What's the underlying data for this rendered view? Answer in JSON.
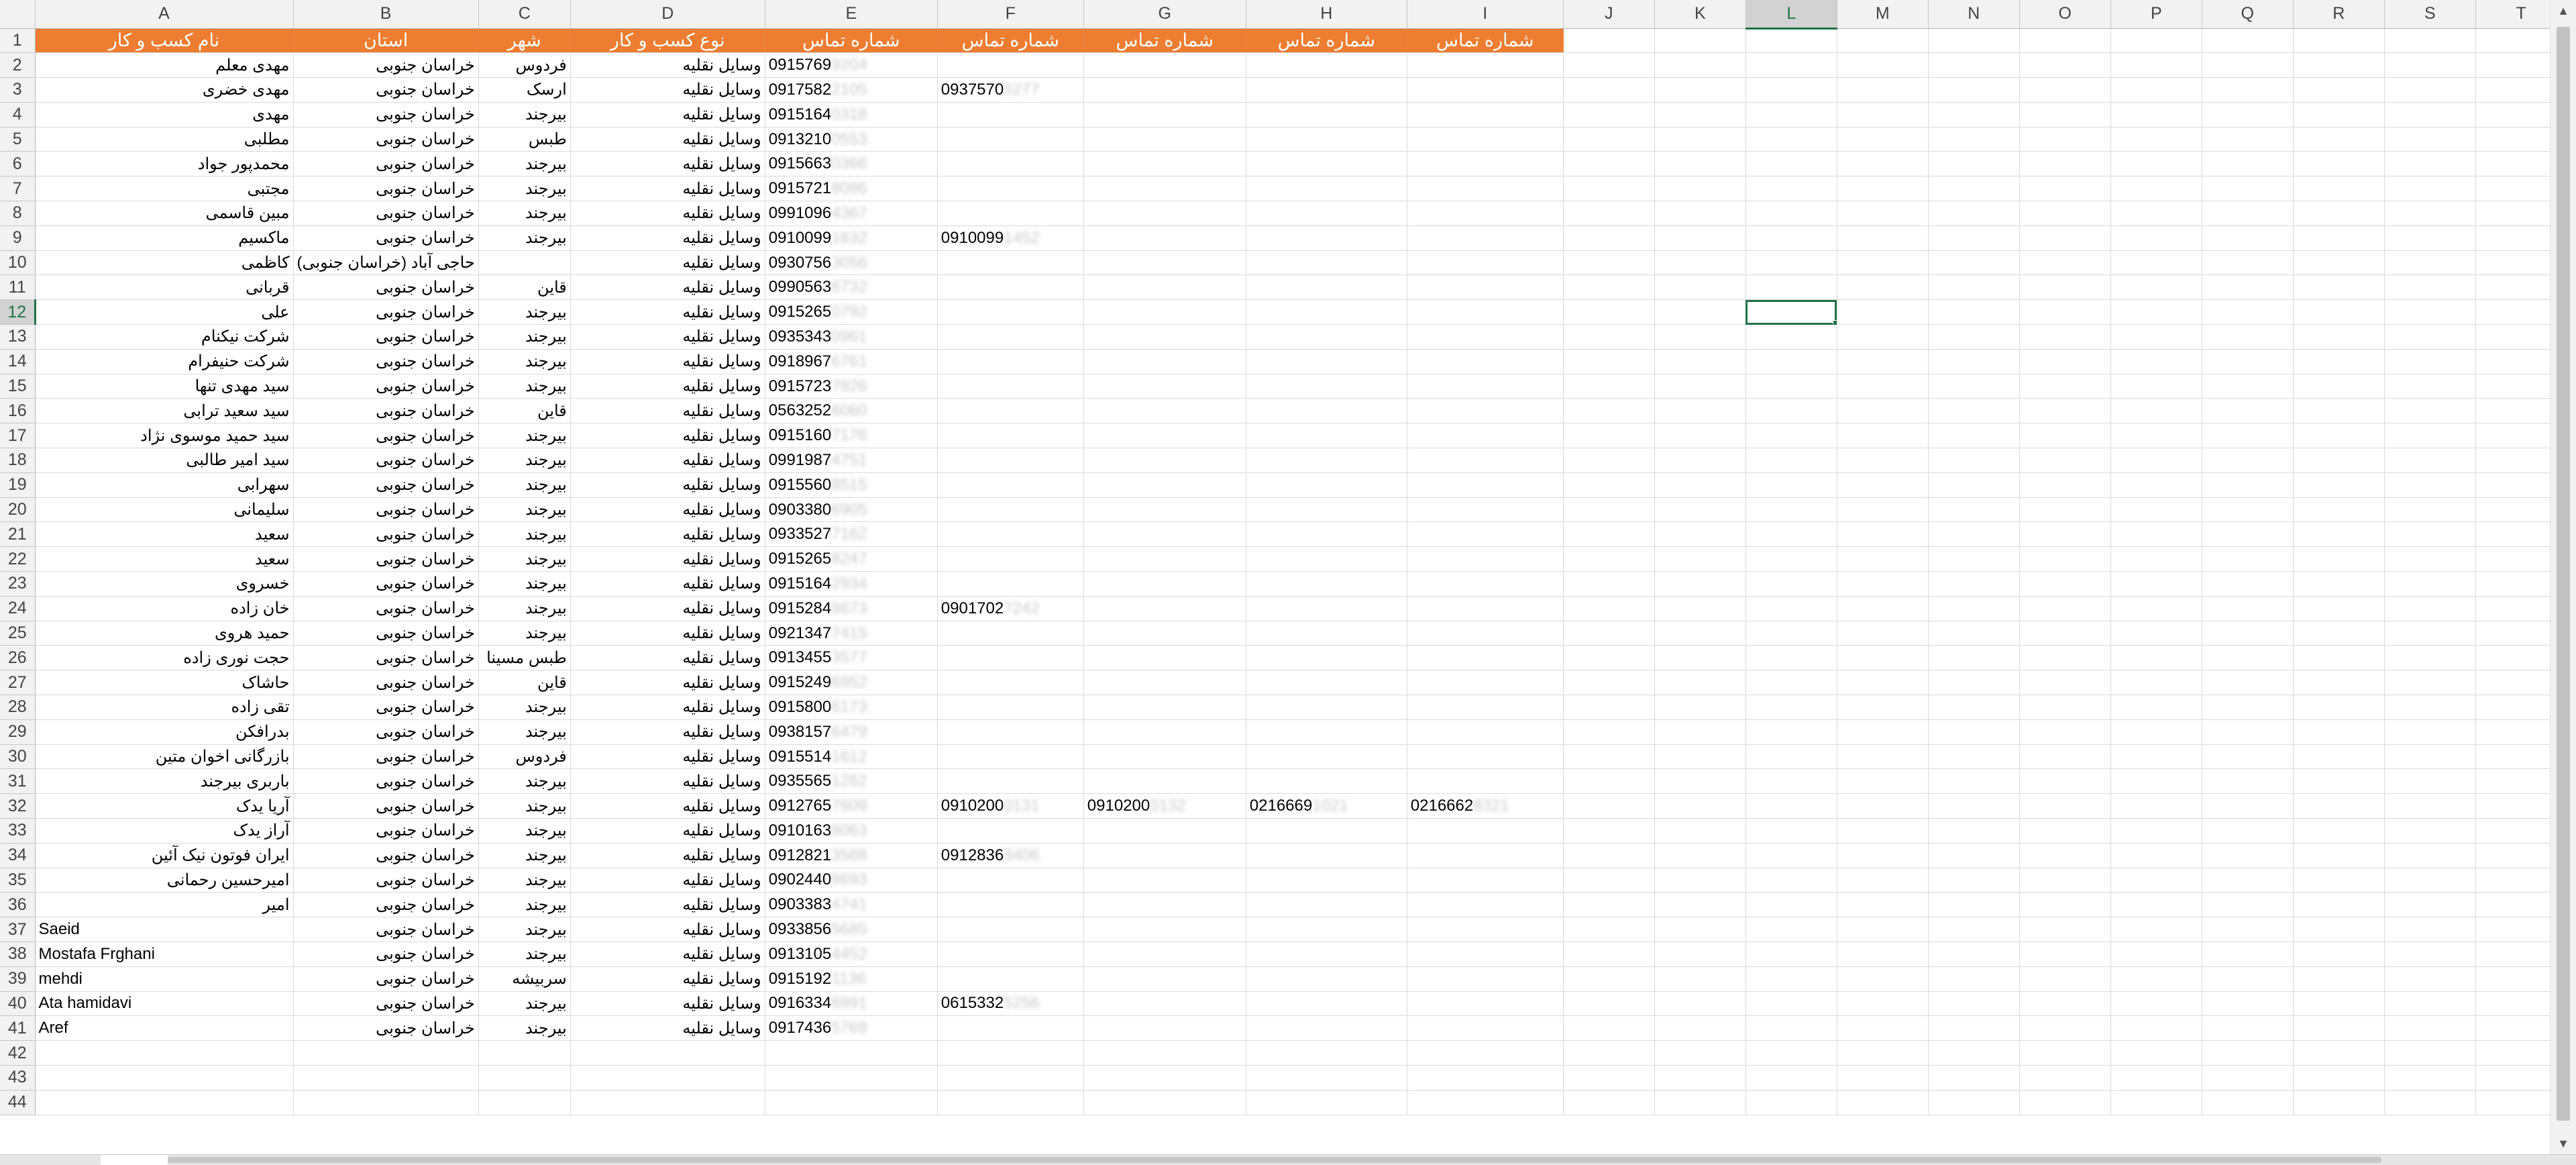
{
  "app": "Spreadsheet",
  "selected_cell": "L12",
  "header_color": "#ed7d31",
  "columns": [
    "A",
    "B",
    "C",
    "D",
    "E",
    "F",
    "G",
    "H",
    "I",
    "J",
    "K",
    "L",
    "M",
    "N",
    "O",
    "P",
    "Q",
    "R",
    "S",
    "T"
  ],
  "row_numbers": [
    1,
    2,
    3,
    4,
    5,
    6,
    7,
    8,
    9,
    10,
    11,
    12,
    13,
    14,
    15,
    16,
    17,
    18,
    19,
    20,
    21,
    22,
    23,
    24,
    25,
    26,
    27,
    28,
    29,
    30,
    31,
    32,
    33,
    34,
    35,
    36,
    37,
    38,
    39,
    40,
    41,
    42,
    43,
    44
  ],
  "headers": [
    "نام کسب و کار",
    "استان",
    "شهر",
    "نوع کسب و کار",
    "شماره تماس",
    "شماره تماس",
    "شماره تماس",
    "شماره تماس",
    "شماره تماس"
  ],
  "rows": [
    {
      "name": "مهدی معلم",
      "province": "خراسان جنوبی",
      "city": "فردوس",
      "type": "وسایل نقلیه",
      "phones": [
        [
          "0915769",
          "9204"
        ]
      ]
    },
    {
      "name": "مهدی خضری",
      "province": "خراسان جنوبی",
      "city": "ارسک",
      "type": "وسایل نقلیه",
      "phones": [
        [
          "0917582",
          "2105"
        ],
        [
          "0937570",
          "5277"
        ]
      ]
    },
    {
      "name": "مهدی",
      "province": "خراسان جنوبی",
      "city": "بیرجند",
      "type": "وسایل نقلیه",
      "phones": [
        [
          "0915164",
          "0318"
        ]
      ]
    },
    {
      "name": "مطلبی",
      "province": "خراسان جنوبی",
      "city": "طبس",
      "type": "وسایل نقلیه",
      "phones": [
        [
          "0913210",
          "0553"
        ]
      ]
    },
    {
      "name": "محمدپور جواد",
      "province": "خراسان جنوبی",
      "city": "بیرجند",
      "type": "وسایل نقلیه",
      "phones": [
        [
          "0915663",
          "0366"
        ]
      ]
    },
    {
      "name": "مجتبی",
      "province": "خراسان جنوبی",
      "city": "بیرجند",
      "type": "وسایل نقلیه",
      "phones": [
        [
          "0915721",
          "8086"
        ]
      ]
    },
    {
      "name": "مبین قاسمی",
      "province": "خراسان جنوبی",
      "city": "بیرجند",
      "type": "وسایل نقلیه",
      "phones": [
        [
          "0991096",
          "4367"
        ]
      ]
    },
    {
      "name": "ماکسیم",
      "province": "خراسان جنوبی",
      "city": "بیرجند",
      "type": "وسایل نقلیه",
      "phones": [
        [
          "0910099",
          "1632"
        ],
        [
          "0910099",
          "1452"
        ]
      ]
    },
    {
      "name": "کاظمی",
      "province": "حاجی آباد (خراسان جنوبی)",
      "city": "",
      "type": "وسایل نقلیه",
      "phones": [
        [
          "0930756",
          "3056"
        ]
      ]
    },
    {
      "name": "قربانی",
      "province": "خراسان جنوبی",
      "city": "قاین",
      "type": "وسایل نقلیه",
      "phones": [
        [
          "0990563",
          "6732"
        ]
      ]
    },
    {
      "name": "علی",
      "province": "خراسان جنوبی",
      "city": "بیرجند",
      "type": "وسایل نقلیه",
      "phones": [
        [
          "0915265",
          "0792"
        ]
      ]
    },
    {
      "name": "شرکت نیکنام",
      "province": "خراسان جنوبی",
      "city": "بیرجند",
      "type": "وسایل نقلیه",
      "phones": [
        [
          "0935343",
          "0961"
        ]
      ]
    },
    {
      "name": "شرکت حنیفرام",
      "province": "خراسان جنوبی",
      "city": "بیرجند",
      "type": "وسایل نقلیه",
      "phones": [
        [
          "0918967",
          "6761"
        ]
      ]
    },
    {
      "name": "سید مهدی تنها",
      "province": "خراسان جنوبی",
      "city": "بیرجند",
      "type": "وسایل نقلیه",
      "phones": [
        [
          "0915723",
          "7926"
        ]
      ]
    },
    {
      "name": "سید سعید ترابی",
      "province": "خراسان جنوبی",
      "city": "قاین",
      "type": "وسایل نقلیه",
      "phones": [
        [
          "0563252",
          "6060"
        ]
      ]
    },
    {
      "name": "سید حمید موسوی نژاد",
      "province": "خراسان جنوبی",
      "city": "بیرجند",
      "type": "وسایل نقلیه",
      "phones": [
        [
          "0915160",
          "7176"
        ]
      ]
    },
    {
      "name": "سید امیر طالبی",
      "province": "خراسان جنوبی",
      "city": "بیرجند",
      "type": "وسایل نقلیه",
      "phones": [
        [
          "0991987",
          "4751"
        ]
      ]
    },
    {
      "name": "سهرابی",
      "province": "خراسان جنوبی",
      "city": "بیرجند",
      "type": "وسایل نقلیه",
      "phones": [
        [
          "0915560",
          "8515"
        ]
      ]
    },
    {
      "name": "سلیمانی",
      "province": "خراسان جنوبی",
      "city": "بیرجند",
      "type": "وسایل نقلیه",
      "phones": [
        [
          "0903380",
          "6905"
        ]
      ]
    },
    {
      "name": "سعید",
      "province": "خراسان جنوبی",
      "city": "بیرجند",
      "type": "وسایل نقلیه",
      "phones": [
        [
          "0933527",
          "7162"
        ]
      ]
    },
    {
      "name": "سعید",
      "province": "خراسان جنوبی",
      "city": "بیرجند",
      "type": "وسایل نقلیه",
      "phones": [
        [
          "0915265",
          "8247"
        ]
      ]
    },
    {
      "name": "خسروی",
      "province": "خراسان جنوبی",
      "city": "بیرجند",
      "type": "وسایل نقلیه",
      "phones": [
        [
          "0915164",
          "2934"
        ]
      ]
    },
    {
      "name": "خان زاده",
      "province": "خراسان جنوبی",
      "city": "بیرجند",
      "type": "وسایل نقلیه",
      "phones": [
        [
          "0915284",
          "8673"
        ],
        [
          "0901702",
          "7242"
        ]
      ]
    },
    {
      "name": "حمید هروی",
      "province": "خراسان جنوبی",
      "city": "بیرجند",
      "type": "وسایل نقلیه",
      "phones": [
        [
          "0921347",
          "7415"
        ]
      ]
    },
    {
      "name": "حجت نوری زاده",
      "province": "خراسان جنوبی",
      "city": "طبس مسینا",
      "type": "وسایل نقلیه",
      "phones": [
        [
          "0913455",
          "3577"
        ]
      ]
    },
    {
      "name": "حاشاک",
      "province": "خراسان جنوبی",
      "city": "قاین",
      "type": "وسایل نقلیه",
      "phones": [
        [
          "0915249",
          "6952"
        ]
      ]
    },
    {
      "name": "تقی زاده",
      "province": "خراسان جنوبی",
      "city": "بیرجند",
      "type": "وسایل نقلیه",
      "phones": [
        [
          "0915800",
          "6173"
        ]
      ]
    },
    {
      "name": "بدرافکن",
      "province": "خراسان جنوبی",
      "city": "بیرجند",
      "type": "وسایل نقلیه",
      "phones": [
        [
          "0938157",
          "6479"
        ]
      ]
    },
    {
      "name": "بازرگانی اخوان متین",
      "province": "خراسان جنوبی",
      "city": "فردوس",
      "type": "وسایل نقلیه",
      "phones": [
        [
          "0915514",
          "1612"
        ]
      ]
    },
    {
      "name": "باربری بیرجند",
      "province": "خراسان جنوبی",
      "city": "بیرجند",
      "type": "وسایل نقلیه",
      "phones": [
        [
          "0935565",
          "1262"
        ]
      ]
    },
    {
      "name": "آریا یدک",
      "province": "خراسان جنوبی",
      "city": "بیرجند",
      "type": "وسایل نقلیه",
      "phones": [
        [
          "0912765",
          "7609"
        ],
        [
          "0910200",
          "0131"
        ],
        [
          "0910200",
          "0132"
        ],
        [
          "0216669",
          "1021"
        ],
        [
          "0216662",
          "8321"
        ]
      ]
    },
    {
      "name": "آراز یدک",
      "province": "خراسان جنوبی",
      "city": "بیرجند",
      "type": "وسایل نقلیه",
      "phones": [
        [
          "0910163",
          "8063"
        ]
      ]
    },
    {
      "name": "ایران فوتون نیک آئین",
      "province": "خراسان جنوبی",
      "city": "بیرجند",
      "type": "وسایل نقلیه",
      "phones": [
        [
          "0912821",
          "3588"
        ],
        [
          "0912836",
          "3406"
        ]
      ]
    },
    {
      "name": "امیرحسین رحمانی",
      "province": "خراسان جنوبی",
      "city": "بیرجند",
      "type": "وسایل نقلیه",
      "phones": [
        [
          "0902440",
          "8693"
        ]
      ]
    },
    {
      "name": "امیر",
      "province": "خراسان جنوبی",
      "city": "بیرجند",
      "type": "وسایل نقلیه",
      "phones": [
        [
          "0903383",
          "4741"
        ]
      ]
    },
    {
      "name": "Saeid",
      "province": "خراسان جنوبی",
      "city": "بیرجند",
      "type": "وسایل نقلیه",
      "phones": [
        [
          "0933856",
          "5685"
        ]
      ]
    },
    {
      "name": "Mostafa Frghani",
      "province": "خراسان جنوبی",
      "city": "بیرجند",
      "type": "وسایل نقلیه",
      "phones": [
        [
          "0913105",
          "4452"
        ]
      ]
    },
    {
      "name": "mehdi",
      "province": "خراسان جنوبی",
      "city": "سربیشه",
      "type": "وسایل نقلیه",
      "phones": [
        [
          "0915192",
          "1136"
        ]
      ]
    },
    {
      "name": "Ata hamidavi",
      "province": "خراسان جنوبی",
      "city": "بیرجند",
      "type": "وسایل نقلیه",
      "phones": [
        [
          "0916334",
          "6991"
        ],
        [
          "0615332",
          "5256"
        ]
      ]
    },
    {
      "name": "Aref",
      "province": "خراسان جنوبی",
      "city": "بیرجند",
      "type": "وسایل نقلیه",
      "phones": [
        [
          "0917436",
          "5769"
        ]
      ]
    }
  ]
}
